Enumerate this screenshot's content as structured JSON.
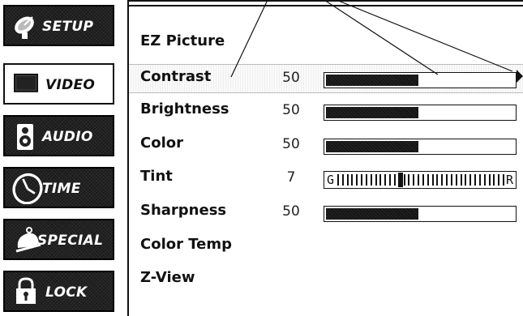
{
  "sidebar": {
    "items": [
      {
        "label": "SETUP",
        "icon": "satellite-dish-icon",
        "selected": false
      },
      {
        "label": "VIDEO",
        "icon": "tv-screen-icon",
        "selected": true
      },
      {
        "label": "AUDIO",
        "icon": "speaker-icon",
        "selected": false
      },
      {
        "label": "TIME",
        "icon": "clock-icon",
        "selected": false
      },
      {
        "label": "SPECIAL",
        "icon": "bell-icon",
        "selected": false
      },
      {
        "label": "LOCK",
        "icon": "padlock-icon",
        "selected": false
      }
    ]
  },
  "menu": {
    "items": [
      {
        "label": "EZ Picture"
      },
      {
        "label": "Contrast",
        "value": "50",
        "level": 0.5,
        "selected": true
      },
      {
        "label": "Brightness",
        "value": "50",
        "level": 0.5
      },
      {
        "label": "Color",
        "value": "50",
        "level": 0.5
      },
      {
        "label": "Tint",
        "value": "7",
        "left_label": "G",
        "right_label": "R"
      },
      {
        "label": "Sharpness",
        "value": "50",
        "level": 0.5
      },
      {
        "label": "Color Temp"
      },
      {
        "label": "Z-View"
      }
    ]
  },
  "colors": {
    "bar_fill": "#151515",
    "background": "#ffffff",
    "sidebar": "#1a1a1a"
  }
}
